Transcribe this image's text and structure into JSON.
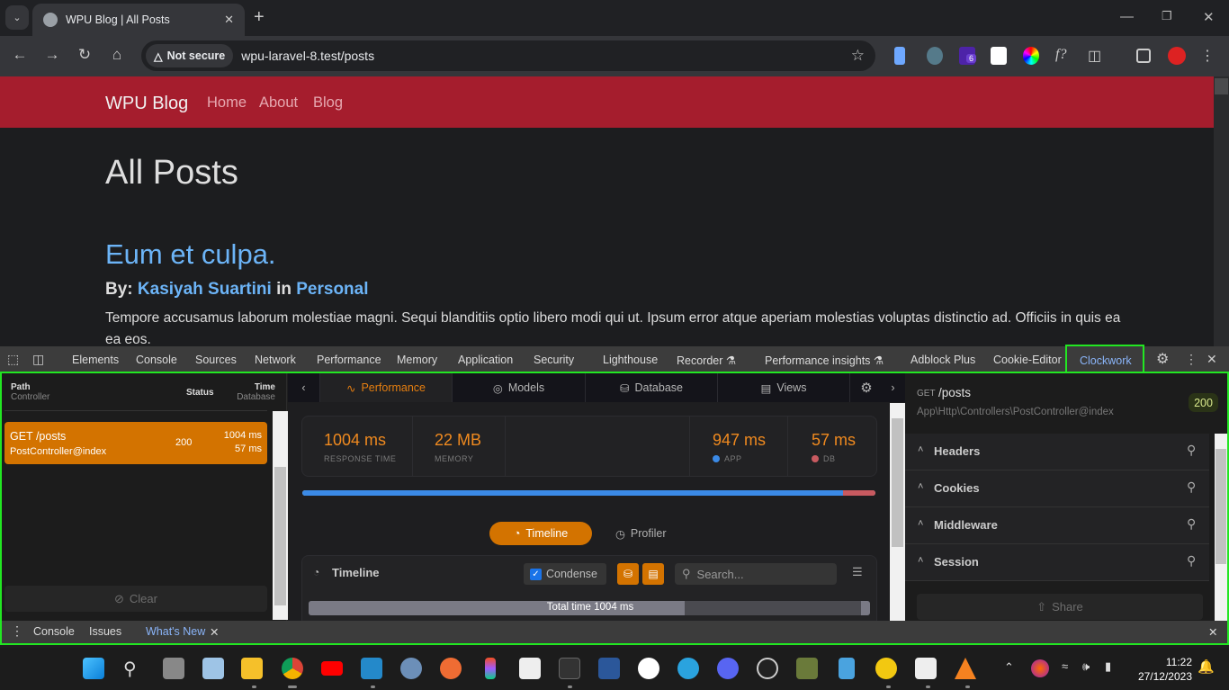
{
  "browser": {
    "tab_title": "WPU Blog | All Posts",
    "security_label": "Not secure",
    "url": "wpu-laravel-8.test/posts",
    "extension_badge": "6",
    "icons": [
      "tab-search-icon",
      "globe-icon",
      "close-icon",
      "new-tab-icon",
      "minimize-icon",
      "restore-icon",
      "window-close-icon",
      "back-icon",
      "forward-icon",
      "reload-icon",
      "home-icon",
      "warning-icon",
      "star-icon",
      "extensions-icon",
      "side-panel-icon",
      "profile-avatar",
      "menu-icon"
    ]
  },
  "page": {
    "brand": "WPU Blog",
    "nav": [
      "Home",
      "About",
      "Blog"
    ],
    "heading": "All Posts",
    "post": {
      "title": "Eum et culpa.",
      "by_label": "By:",
      "author": "Kasiyah Suartini",
      "in_label": "in",
      "category": "Personal",
      "excerpt": "Tempore accusamus laborum molestiae magni. Sequi blanditiis optio libero modi qui ut. Ipsum error atque aperiam molestias voluptas distinctio ad. Officiis in quis ea ea eos."
    },
    "colors": {
      "navbar": "#a51d2d",
      "link": "#6cb4f7"
    }
  },
  "devtools": {
    "tabs": [
      "Elements",
      "Console",
      "Sources",
      "Network",
      "Performance",
      "Memory",
      "Application",
      "Security",
      "Lighthouse",
      "Recorder",
      "Performance insights",
      "Adblock Plus",
      "Cookie-Editor",
      "Clockwork"
    ],
    "active_tab": "Clockwork",
    "drawer_tabs": [
      "Console",
      "Issues",
      "What's New"
    ],
    "active_drawer_tab": "What's New"
  },
  "clockwork": {
    "list_headers": {
      "path": "Path",
      "controller": "Controller",
      "status": "Status",
      "time": "Time",
      "database": "Database"
    },
    "requests": [
      {
        "method_path": "GET /posts",
        "controller": "PostController@index",
        "status": "200",
        "time": "1004 ms",
        "db_time": "57 ms"
      }
    ],
    "clear_label": "Clear",
    "tabs": [
      "Performance",
      "Models",
      "Database",
      "Views"
    ],
    "active_tab": "Performance",
    "stats": {
      "response_time": {
        "value": "1004 ms",
        "label": "RESPONSE TIME"
      },
      "memory": {
        "value": "22 MB",
        "label": "MEMORY"
      },
      "app": {
        "value": "947 ms",
        "label": "APP"
      },
      "db": {
        "value": "57 ms",
        "label": "DB"
      }
    },
    "perf_bar": {
      "app_ms": 947,
      "db_ms": 57,
      "total_ms": 1004,
      "app_color": "#3b8ae6",
      "db_color": "#c85a60"
    },
    "view_toggle": {
      "timeline": "Timeline",
      "profiler": "Profiler",
      "active": "Timeline"
    },
    "timeline": {
      "title": "Timeline",
      "condense_label": "Condense",
      "condense_checked": true,
      "search_placeholder": "Search...",
      "total_label": "Total time 1004 ms",
      "total_fill_fraction": 0.67
    },
    "detail": {
      "method": "GET",
      "path": "/posts",
      "controller": "App\\Http\\Controllers\\PostController@index",
      "status": "200",
      "sections": [
        "Headers",
        "Cookies",
        "Middleware",
        "Session"
      ],
      "share_label": "Share"
    },
    "accent": "#d37300"
  },
  "taskbar": {
    "time": "11:22",
    "date": "27/12/2023",
    "apps": [
      "start",
      "search",
      "task-view",
      "resource-monitor",
      "file-explorer",
      "chrome",
      "youtube",
      "vscode",
      "postgresql",
      "postman",
      "figma",
      "notion",
      "terminal",
      "word",
      "whatsapp",
      "telegram",
      "discord",
      "obs",
      "tree-app",
      "notepad",
      "bitwarden-app",
      "notion-2",
      "vlc"
    ]
  }
}
